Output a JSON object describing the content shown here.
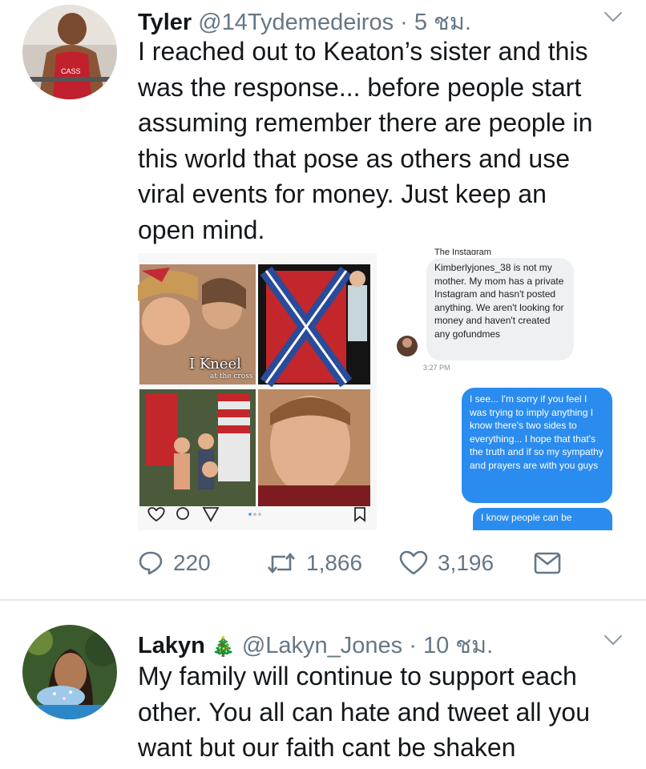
{
  "tweet1": {
    "name": "Tyler",
    "handle": "@14Tydemedeiros",
    "sep": "·",
    "time": "5 ชม.",
    "text": "I reached out to Keaton’s sister and this\nwas the response... before people start\nassuming remember there are people in\nthis world that pose as others and use\nviral events for money.  Just keep an\nopen mind.",
    "media": {
      "kneel_title": "I Kneel",
      "kneel_sub": "at the cross",
      "dm_cut_top": "The Instagram",
      "dm_incoming": "Kimberlyjones_38 is not my mother. My mom has a private Instagram and hasn't posted anything. We aren't looking for money and haven't created any gofundmes",
      "dm_time": "3:27 PM",
      "dm_outgoing_1": "I see... I'm sorry if you feel I was trying to imply anything I know there's two sides to everything... I hope that that's the truth and if so my sympathy and prayers are with you guys",
      "dm_outgoing_2": "I know people can be"
    },
    "actions": {
      "replies": "220",
      "retweets": "1,866",
      "likes": "3,196"
    }
  },
  "tweet2": {
    "name": "Lakyn",
    "emoji": "🎄",
    "handle": "@Lakyn_Jones",
    "sep": "·",
    "time": "10 ชม.",
    "text": "My family will continue to support each\nother. You all can hate and tweet all you\nwant but our faith cant be shaken"
  },
  "colors": {
    "text": "#14171a",
    "muted": "#657786",
    "divider": "#e1e8ed",
    "dm_blue": "#2b8cf0"
  }
}
